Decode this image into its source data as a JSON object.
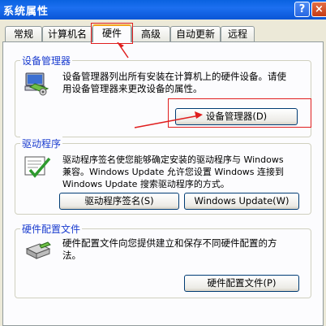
{
  "window": {
    "title": "系统属性",
    "help_label": "?",
    "close_label": "×"
  },
  "tabs": [
    {
      "label": "常规"
    },
    {
      "label": "计算机名"
    },
    {
      "label": "硬件"
    },
    {
      "label": "高级"
    },
    {
      "label": "自动更新"
    },
    {
      "label": "远程"
    }
  ],
  "device_manager": {
    "title": "设备管理器",
    "desc_line1": "设备管理器列出所有安装在计算机上的硬件设备。请使",
    "desc_line2": "用设备管理器来更改设备的属性。",
    "button_label": "设备管理器(D)"
  },
  "drivers": {
    "title": "驱动程序",
    "desc_line1": "驱动程序签名使您能够确定安装的驱动程序与 Windows",
    "desc_line2": "兼容。Windows Update 允许您设置 Windows 连接到",
    "desc_line3": "Windows Update 搜索驱动程序的方式。",
    "signing_button_label": "驱动程序签名(S)",
    "update_button_label": "Windows Update(W)"
  },
  "hardware_profiles": {
    "title": "硬件配置文件",
    "desc_line1": "硬件配置文件向您提供建立和保存不同硬件配置的方",
    "desc_line2": "法。",
    "button_label": "硬件配置文件(P)"
  },
  "colors": {
    "annotation_red": "#e01e1e",
    "legend_blue": "#1a3ccf",
    "titlebar_blue": "#0a5ce0",
    "active_tab_accent": "#f4a41c"
  }
}
